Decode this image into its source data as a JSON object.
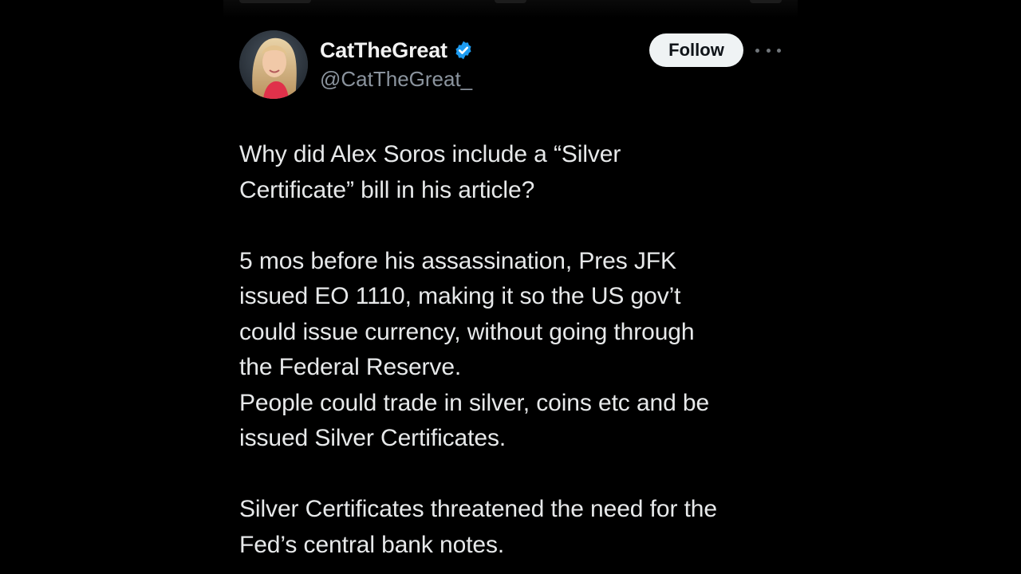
{
  "tweet": {
    "author": {
      "display_name": "CatTheGreat",
      "handle": "@CatTheGreat_",
      "verified": true,
      "avatar_icon": "profile-photo"
    },
    "actions": {
      "follow_label": "Follow",
      "more_icon": "more-horizontal-icon"
    },
    "text_lines": [
      "Why did Alex Soros include a “Silver",
      "Certificate” bill in his article?",
      "",
      "5 mos before his assassination, Pres JFK",
      "issued EO 1110, making it so the US gov’t",
      "could issue currency, without going through",
      "the Federal Reserve.",
      "People could trade in silver, coins etc and be",
      "issued Silver Certificates.",
      "",
      "Silver Certificates threatened the need for the",
      "Fed’s central bank notes."
    ]
  },
  "colors": {
    "background": "#000000",
    "text_primary": "#e7e9ea",
    "text_secondary": "#8b949e",
    "verified_badge": "#1d9bf0",
    "follow_button_bg": "#eff3f4",
    "follow_button_text": "#0f1419"
  }
}
